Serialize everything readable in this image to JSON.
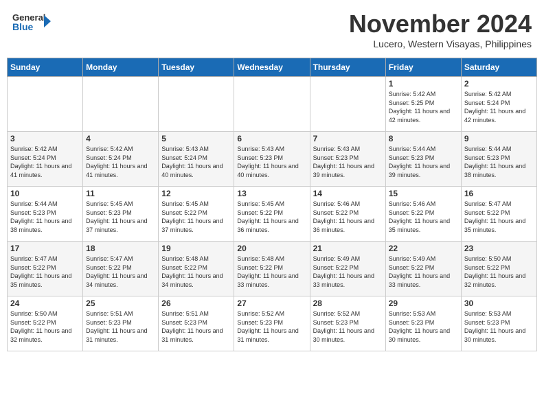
{
  "header": {
    "logo_line1": "General",
    "logo_line2": "Blue",
    "month": "November 2024",
    "location": "Lucero, Western Visayas, Philippines"
  },
  "days_of_week": [
    "Sunday",
    "Monday",
    "Tuesday",
    "Wednesday",
    "Thursday",
    "Friday",
    "Saturday"
  ],
  "weeks": [
    [
      {
        "day": "",
        "info": ""
      },
      {
        "day": "",
        "info": ""
      },
      {
        "day": "",
        "info": ""
      },
      {
        "day": "",
        "info": ""
      },
      {
        "day": "",
        "info": ""
      },
      {
        "day": "1",
        "info": "Sunrise: 5:42 AM\nSunset: 5:25 PM\nDaylight: 11 hours and 42 minutes."
      },
      {
        "day": "2",
        "info": "Sunrise: 5:42 AM\nSunset: 5:24 PM\nDaylight: 11 hours and 42 minutes."
      }
    ],
    [
      {
        "day": "3",
        "info": "Sunrise: 5:42 AM\nSunset: 5:24 PM\nDaylight: 11 hours and 41 minutes."
      },
      {
        "day": "4",
        "info": "Sunrise: 5:42 AM\nSunset: 5:24 PM\nDaylight: 11 hours and 41 minutes."
      },
      {
        "day": "5",
        "info": "Sunrise: 5:43 AM\nSunset: 5:24 PM\nDaylight: 11 hours and 40 minutes."
      },
      {
        "day": "6",
        "info": "Sunrise: 5:43 AM\nSunset: 5:23 PM\nDaylight: 11 hours and 40 minutes."
      },
      {
        "day": "7",
        "info": "Sunrise: 5:43 AM\nSunset: 5:23 PM\nDaylight: 11 hours and 39 minutes."
      },
      {
        "day": "8",
        "info": "Sunrise: 5:44 AM\nSunset: 5:23 PM\nDaylight: 11 hours and 39 minutes."
      },
      {
        "day": "9",
        "info": "Sunrise: 5:44 AM\nSunset: 5:23 PM\nDaylight: 11 hours and 38 minutes."
      }
    ],
    [
      {
        "day": "10",
        "info": "Sunrise: 5:44 AM\nSunset: 5:23 PM\nDaylight: 11 hours and 38 minutes."
      },
      {
        "day": "11",
        "info": "Sunrise: 5:45 AM\nSunset: 5:23 PM\nDaylight: 11 hours and 37 minutes."
      },
      {
        "day": "12",
        "info": "Sunrise: 5:45 AM\nSunset: 5:22 PM\nDaylight: 11 hours and 37 minutes."
      },
      {
        "day": "13",
        "info": "Sunrise: 5:45 AM\nSunset: 5:22 PM\nDaylight: 11 hours and 36 minutes."
      },
      {
        "day": "14",
        "info": "Sunrise: 5:46 AM\nSunset: 5:22 PM\nDaylight: 11 hours and 36 minutes."
      },
      {
        "day": "15",
        "info": "Sunrise: 5:46 AM\nSunset: 5:22 PM\nDaylight: 11 hours and 35 minutes."
      },
      {
        "day": "16",
        "info": "Sunrise: 5:47 AM\nSunset: 5:22 PM\nDaylight: 11 hours and 35 minutes."
      }
    ],
    [
      {
        "day": "17",
        "info": "Sunrise: 5:47 AM\nSunset: 5:22 PM\nDaylight: 11 hours and 35 minutes."
      },
      {
        "day": "18",
        "info": "Sunrise: 5:47 AM\nSunset: 5:22 PM\nDaylight: 11 hours and 34 minutes."
      },
      {
        "day": "19",
        "info": "Sunrise: 5:48 AM\nSunset: 5:22 PM\nDaylight: 11 hours and 34 minutes."
      },
      {
        "day": "20",
        "info": "Sunrise: 5:48 AM\nSunset: 5:22 PM\nDaylight: 11 hours and 33 minutes."
      },
      {
        "day": "21",
        "info": "Sunrise: 5:49 AM\nSunset: 5:22 PM\nDaylight: 11 hours and 33 minutes."
      },
      {
        "day": "22",
        "info": "Sunrise: 5:49 AM\nSunset: 5:22 PM\nDaylight: 11 hours and 33 minutes."
      },
      {
        "day": "23",
        "info": "Sunrise: 5:50 AM\nSunset: 5:22 PM\nDaylight: 11 hours and 32 minutes."
      }
    ],
    [
      {
        "day": "24",
        "info": "Sunrise: 5:50 AM\nSunset: 5:22 PM\nDaylight: 11 hours and 32 minutes."
      },
      {
        "day": "25",
        "info": "Sunrise: 5:51 AM\nSunset: 5:23 PM\nDaylight: 11 hours and 31 minutes."
      },
      {
        "day": "26",
        "info": "Sunrise: 5:51 AM\nSunset: 5:23 PM\nDaylight: 11 hours and 31 minutes."
      },
      {
        "day": "27",
        "info": "Sunrise: 5:52 AM\nSunset: 5:23 PM\nDaylight: 11 hours and 31 minutes."
      },
      {
        "day": "28",
        "info": "Sunrise: 5:52 AM\nSunset: 5:23 PM\nDaylight: 11 hours and 30 minutes."
      },
      {
        "day": "29",
        "info": "Sunrise: 5:53 AM\nSunset: 5:23 PM\nDaylight: 11 hours and 30 minutes."
      },
      {
        "day": "30",
        "info": "Sunrise: 5:53 AM\nSunset: 5:23 PM\nDaylight: 11 hours and 30 minutes."
      }
    ]
  ]
}
